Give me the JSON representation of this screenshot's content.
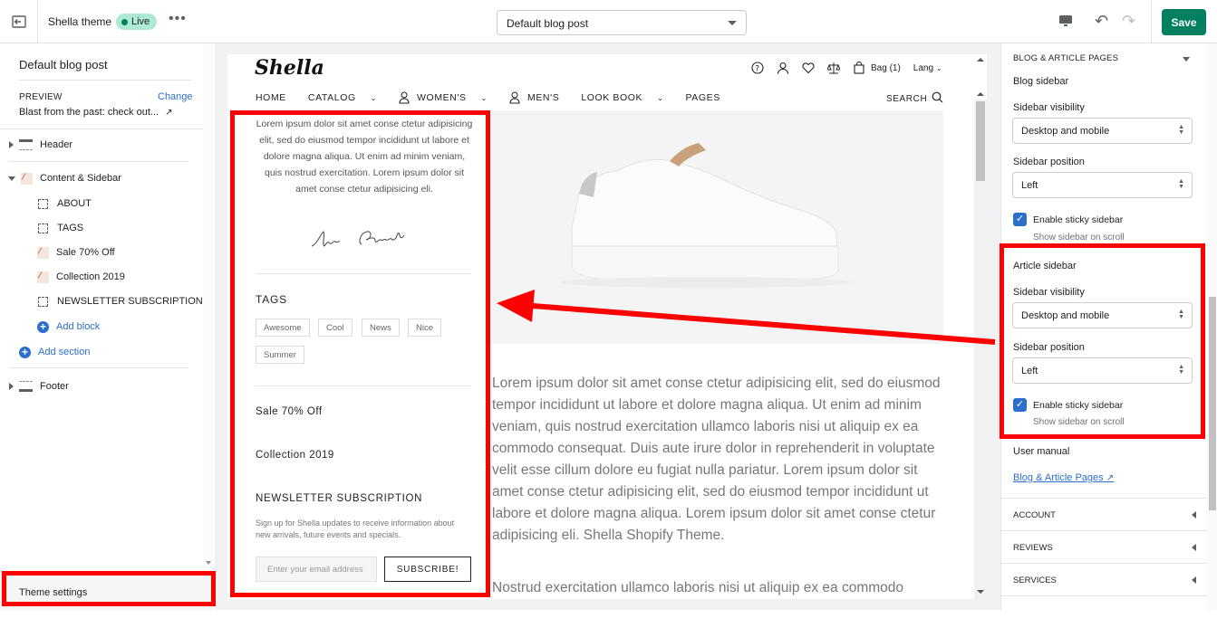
{
  "topbar": {
    "theme_name": "Shella theme",
    "live_badge": "Live",
    "more": "•••",
    "template_select": "Default blog post",
    "save_label": "Save"
  },
  "left_panel": {
    "title": "Default blog post",
    "preview_label": "PREVIEW",
    "change_label": "Change",
    "preview_value": "Blast from the past: check out...",
    "sections": [
      {
        "label": "Header"
      },
      {
        "label": "Content & Sidebar"
      },
      {
        "label": "ABOUT"
      },
      {
        "label": "TAGS"
      },
      {
        "label": "Sale 70% Off"
      },
      {
        "label": "Collection 2019"
      },
      {
        "label": "NEWSLETTER SUBSCRIPTION"
      },
      {
        "label": "Add block"
      },
      {
        "label": "Add section"
      },
      {
        "label": "Footer"
      }
    ],
    "theme_settings": "Theme settings"
  },
  "store": {
    "logo": "Shella",
    "bag": "Bag (1)",
    "lang": "Lang",
    "nav": [
      "HOME",
      "CATALOG",
      "WOMEN'S",
      "MEN'S",
      "LOOK BOOK",
      "PAGES"
    ],
    "search": "SEARCH",
    "about_text": "Lorem ipsum dolor sit amet conse ctetur adipisicing elit, sed do eiusmod tempor incididunt ut labore et dolore magna aliqua. Ut enim ad minim veniam, quis nostrud exercitation. Lorem ipsum dolor sit amet conse ctetur adipisicing eli.",
    "signature": "Annie Gleenbeck",
    "tags_heading": "TAGS",
    "tags": [
      "Awesome",
      "Cool",
      "News",
      "Nice",
      "Summer"
    ],
    "sale_heading": "Sale 70% Off",
    "collection_heading": "Collection 2019",
    "newsletter_heading": "NEWSLETTER SUBSCRIPTION",
    "newsletter_text": "Sign up for Shella updates to receive information about new arrivals, future events and specials.",
    "email_placeholder": "Enter your email address",
    "subscribe": "SUBSCRIBE!",
    "article_p1": "Lorem ipsum dolor sit amet conse ctetur adipisicing elit, sed do eiusmod tempor incididunt ut labore et dolore magna aliqua. Ut enim ad minim veniam, quis nostrud exercitation ullamco laboris nisi ut aliquip ex ea commodo consequat. Duis aute irure dolor in reprehenderit in voluptate velit esse cillum dolore eu fugiat nulla pariatur. Lorem ipsum dolor sit amet conse ctetur adipisicing elit, sed do eiusmod tempor incididunt ut labore et dolore magna aliqua. Lorem ipsum dolor sit amet conse ctetur adipisicing eli. Shella Shopify Theme.",
    "article_p2": "Nostrud exercitation ullamco laboris nisi ut aliquip ex ea commodo"
  },
  "right_panel": {
    "section_title": "BLOG & ARTICLE PAGES",
    "blog_sidebar": "Blog sidebar",
    "sidebar_visibility": "Sidebar visibility",
    "visibility_value": "Desktop and mobile",
    "sidebar_position": "Sidebar position",
    "position_value": "Left",
    "sticky_label": "Enable sticky sidebar",
    "sticky_help": "Show sidebar on scroll",
    "article_sidebar": "Article sidebar",
    "article_visibility_value": "Desktop and mobile",
    "article_position_value": "Left",
    "user_manual": "User manual",
    "manual_link": "Blog & Article Pages",
    "accordions": [
      "ACCOUNT",
      "REVIEWS",
      "SERVICES"
    ]
  },
  "colors": {
    "accent": "#008060",
    "link": "#2c6ecb",
    "highlight": "#ff0000"
  }
}
